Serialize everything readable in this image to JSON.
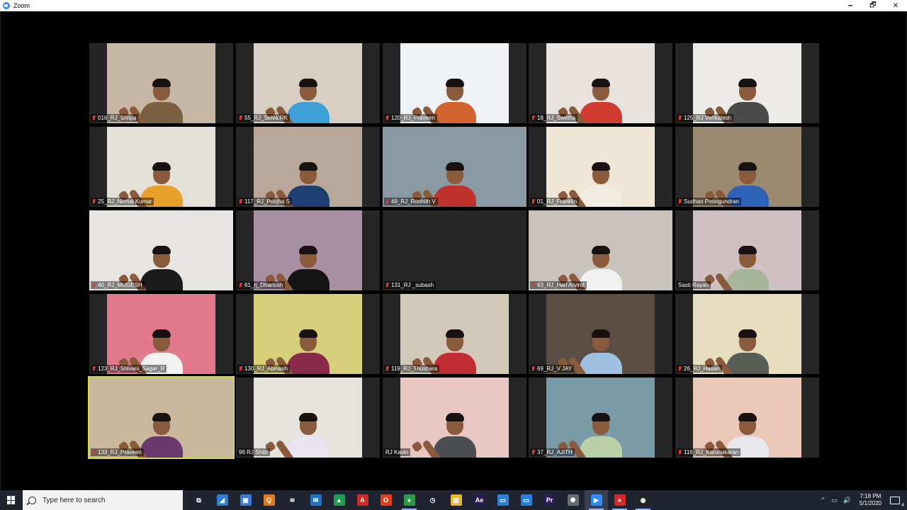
{
  "window": {
    "title": "Zoom",
    "minimize": "🗕",
    "maximize": "🗗",
    "close": "✕"
  },
  "participants": [
    {
      "name": "016_RJ_Shilpa",
      "bg": "#c9b7a6",
      "shirt": "#7a6040",
      "muted": true
    },
    {
      "name": "55_RJ_Selva.RK",
      "bg": "#d8cfc4",
      "shirt": "#3fa0d8",
      "muted": true
    },
    {
      "name": "120_RJ_Praveen",
      "bg": "#eef2f5",
      "shirt": "#d2652d",
      "muted": true
    },
    {
      "name": "18_RJ_Swetha",
      "bg": "#e8e3df",
      "shirt": "#d03a2f",
      "muted": true
    },
    {
      "name": "125_RJ Venkatesh",
      "bg": "#ecebe8",
      "shirt": "#4a4a4a",
      "muted": true
    },
    {
      "name": "25_RJ_Nirmal Kumar",
      "bg": "#e3e1d8",
      "shirt": "#e8a12a",
      "muted": true
    },
    {
      "name": "117_RJ_Poojha S",
      "bg": "#b9a89a",
      "shirt": "#1f3f73",
      "muted": true
    },
    {
      "name": "49_RJ_Roohith V",
      "bg": "#8a9aa3",
      "shirt": "#c0322c",
      "muted": true,
      "wide": true
    },
    {
      "name": "01_RJ_Franklin",
      "bg": "#efe6d6",
      "shirt": "#f2ece2",
      "muted": true
    },
    {
      "name": "Sudhan Poongundran",
      "bg": "#9c8a70",
      "shirt": "#2f63b8",
      "muted": true
    },
    {
      "name": "40_RJ_MUGESH",
      "bg": "#e7e5e2",
      "shirt": "#1b1b1b",
      "muted": true,
      "wide": true
    },
    {
      "name": "61_rj_Dhanush",
      "bg": "#a88fa2",
      "shirt": "#151515",
      "muted": true
    },
    {
      "name": "131_RJ _subash",
      "bg": "#262626",
      "shirt": "#262626",
      "muted": true,
      "empty": true
    },
    {
      "name": "63_RJ_Hari Arvind",
      "bg": "#c9c3bd",
      "shirt": "#f1f1f1",
      "muted": true,
      "wide": true
    },
    {
      "name": "Sasti Rayan",
      "bg": "#cfc0c4",
      "shirt": "#a7b59a",
      "muted": false
    },
    {
      "name": "123_RJ_Shivani_Sagar_R",
      "bg": "#e07a8c",
      "shirt": "#f1f1f1",
      "muted": true
    },
    {
      "name": "130_RJ_Abinash",
      "bg": "#d8cf7a",
      "shirt": "#8a2a4a",
      "muted": true
    },
    {
      "name": "119_RJ_Thushara",
      "bg": "#d2c9b9",
      "shirt": "#c02e33",
      "muted": true
    },
    {
      "name": "69_RJ_V JAY",
      "bg": "#5a4e44",
      "shirt": "#9fc0e0",
      "muted": true
    },
    {
      "name": "26_RJ_Hasan",
      "bg": "#e6dcc0",
      "shirt": "#5a5d55",
      "muted": true
    },
    {
      "name": "133_RJ_Praveen",
      "bg": "#c9b89e",
      "shirt": "#6a3a6e",
      "muted": true,
      "active": true,
      "wide": true
    },
    {
      "name": "96 RJ Shibi",
      "bg": "#e6e2dc",
      "shirt": "#e8e4f2",
      "muted": false
    },
    {
      "name": "RJ Kavin",
      "bg": "#e9c7c3",
      "shirt": "#4b4f52",
      "muted": false
    },
    {
      "name": "37_RJ_AJITH",
      "bg": "#7a9aa8",
      "shirt": "#b9d0a8",
      "muted": true
    },
    {
      "name": "116_RJ_Karunakaran",
      "bg": "#e9c8b8",
      "shirt": "#e8e8ec",
      "muted": true
    }
  ],
  "taskbar": {
    "search_placeholder": "Type here to search",
    "apps": [
      {
        "name": "task-view",
        "label": "⧉",
        "color": "transparent",
        "running": false
      },
      {
        "name": "edge-legacy",
        "label": "◢",
        "color": "#2f7fd1",
        "running": false
      },
      {
        "name": "store",
        "label": "▣",
        "color": "#3c7ad6",
        "running": false
      },
      {
        "name": "qbittorrent",
        "label": "Q",
        "color": "#e07a1f",
        "running": false
      },
      {
        "name": "network",
        "label": "≋",
        "color": "transparent",
        "running": false
      },
      {
        "name": "mail",
        "label": "✉",
        "color": "#1f73c9",
        "running": false
      },
      {
        "name": "google-drive",
        "label": "▲",
        "color": "#1f9d55",
        "running": false
      },
      {
        "name": "acrobat",
        "label": "A",
        "color": "#d12a2a",
        "running": false
      },
      {
        "name": "office",
        "label": "O",
        "color": "#e2401c",
        "running": false
      },
      {
        "name": "chrome",
        "label": "●",
        "color": "#2b9b45",
        "running": true
      },
      {
        "name": "clock-app",
        "label": "◷",
        "color": "transparent",
        "running": false
      },
      {
        "name": "file-explorer",
        "label": "▤",
        "color": "#e8b733",
        "running": false
      },
      {
        "name": "after-effects",
        "label": "Ae",
        "color": "#2a1d55",
        "running": false
      },
      {
        "name": "snipping",
        "label": "▭",
        "color": "#2d7fd8",
        "running": false
      },
      {
        "name": "windows-app",
        "label": "▭",
        "color": "#2d7fd8",
        "running": false
      },
      {
        "name": "premiere",
        "label": "Pr",
        "color": "#2a1d55",
        "running": false
      },
      {
        "name": "davinci",
        "label": "✺",
        "color": "#6d6d6d",
        "running": false
      },
      {
        "name": "zoom",
        "label": "▶",
        "color": "#2d8cff",
        "running": true,
        "current": true
      },
      {
        "name": "recorder",
        "label": "●",
        "color": "#d12a2a",
        "running": true
      },
      {
        "name": "obs",
        "label": "◉",
        "color": "#222",
        "running": true
      }
    ],
    "tray": {
      "chevron": "⌃",
      "network": "▭",
      "volume": "🔊",
      "time": "7:18 PM",
      "date": "5/1/2020",
      "notifications": "4"
    }
  }
}
